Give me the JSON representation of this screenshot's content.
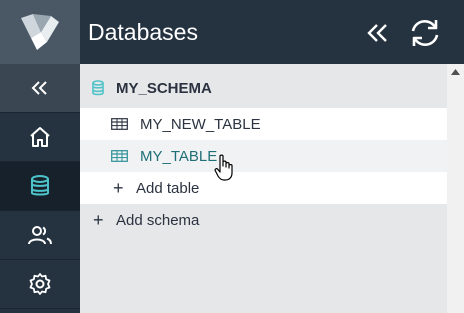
{
  "header": {
    "title": "Databases"
  },
  "tree": {
    "schema_name": "MY_SCHEMA",
    "tables": [
      {
        "label": "MY_NEW_TABLE"
      },
      {
        "label": "MY_TABLE"
      }
    ],
    "add_table_label": "Add table",
    "add_schema_label": "Add schema",
    "plus_glyph": "+"
  },
  "icons": {
    "logo": "app-logo",
    "collapse_rail": "chevrons-left-icon",
    "home": "home-icon",
    "databases": "database-icon",
    "users": "users-icon",
    "settings": "gear-icon",
    "collapse_panel": "chevrons-left-icon",
    "refresh": "refresh-icon",
    "table": "table-icon"
  },
  "colors": {
    "accent": "#4ec3c9",
    "rail_bg": "#253340",
    "active_bg": "#16212b",
    "panel_bg": "#e6e7e9"
  }
}
